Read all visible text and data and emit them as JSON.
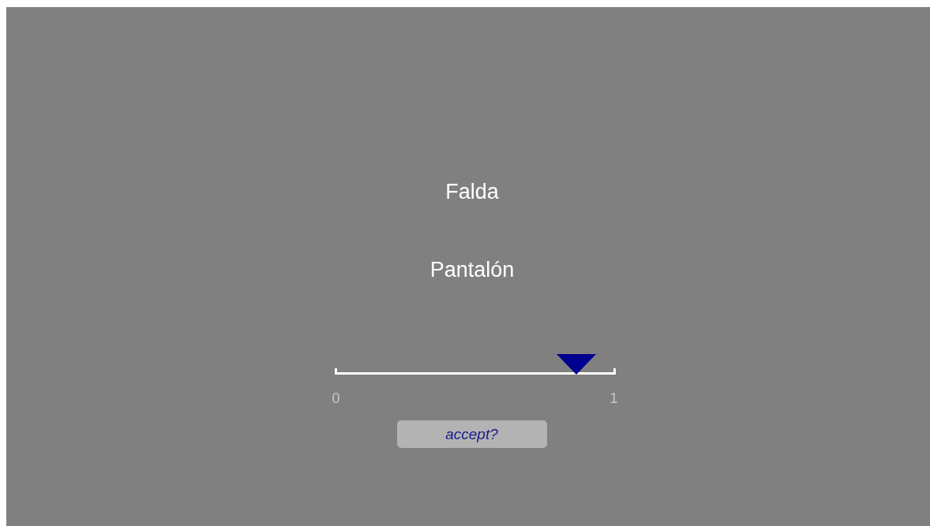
{
  "stimuli": [
    {
      "text": "Falda"
    },
    {
      "text": "Pantalón"
    }
  ],
  "slider": {
    "level": 0.86,
    "min_label": "0",
    "max_label": "1"
  },
  "button": {
    "label": "accept?"
  }
}
